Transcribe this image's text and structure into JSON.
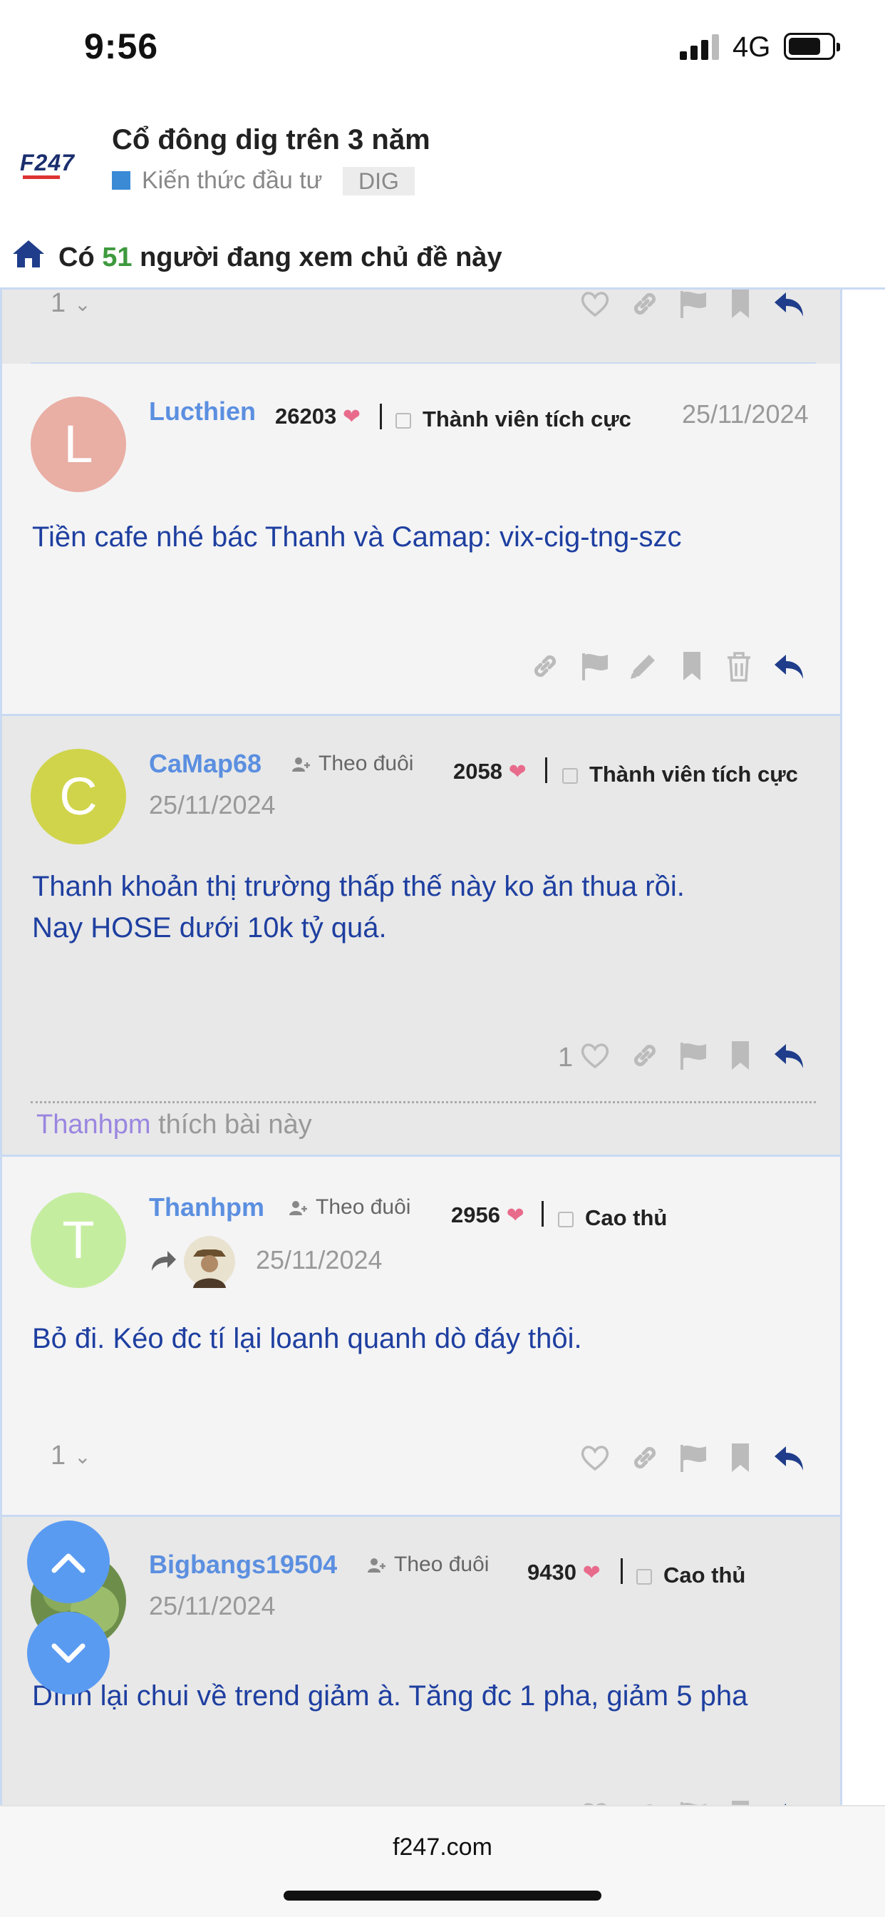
{
  "status_bar": {
    "time": "9:56",
    "network": "4G"
  },
  "header": {
    "logo_text": "F247",
    "topic_title": "Cổ đông dig trên 3 năm",
    "category": "Kiến thức đầu tư",
    "tag": "DIG"
  },
  "viewers": {
    "prefix": "Có",
    "count": "51",
    "suffix": "người đang xem chủ đề này"
  },
  "top_stub": {
    "like_count": "1"
  },
  "posts": [
    {
      "username": "Lucthien",
      "avatar_letter": "L",
      "avatar_color": "#e9aea4",
      "score": "26203",
      "rank": "Thành viên tích cực",
      "date": "25/11/2024",
      "content": [
        "Tiền cafe nhé bác Thanh và Camap: vix-cig-tng-szc"
      ]
    },
    {
      "username": "CaMap68",
      "avatar_letter": "C",
      "avatar_color": "#d0d44a",
      "follow_label": "Theo đuôi",
      "score": "2058",
      "rank": "Thành viên tích cực",
      "date": "25/11/2024",
      "content": [
        "Thanh khoản thị trường thấp thế này ko ăn thua rồi.",
        "Nay HOSE dưới 10k tỷ quá."
      ],
      "like_count": "1",
      "liked_by_user": "Thanhpm",
      "liked_by_text": "thích bài này"
    },
    {
      "username": "Thanhpm",
      "avatar_letter": "T",
      "avatar_color": "#c5eda0",
      "follow_label": "Theo đuôi",
      "score": "2956",
      "rank": "Cao thủ",
      "date": "25/11/2024",
      "content": [
        "Bỏ đi. Kéo đc tí lại loanh quanh dò đáy thôi."
      ],
      "like_count": "1"
    },
    {
      "username": "Bigbangs19504",
      "follow_label": "Theo đuôi",
      "score": "9430",
      "rank": "Cao thủ",
      "date": "25/11/2024",
      "content": [
        "Dính lại chui về trend giảm à. Tăng đc 1 pha, giảm 5 pha"
      ]
    }
  ],
  "bottom": {
    "domain": "f247.com"
  },
  "colors": {
    "accent": "#5b8fe0",
    "content_text": "#1e3fa0",
    "fab": "#5a9bf2",
    "heart": "#e86b8c",
    "viewer_count": "#3e9a3e"
  }
}
